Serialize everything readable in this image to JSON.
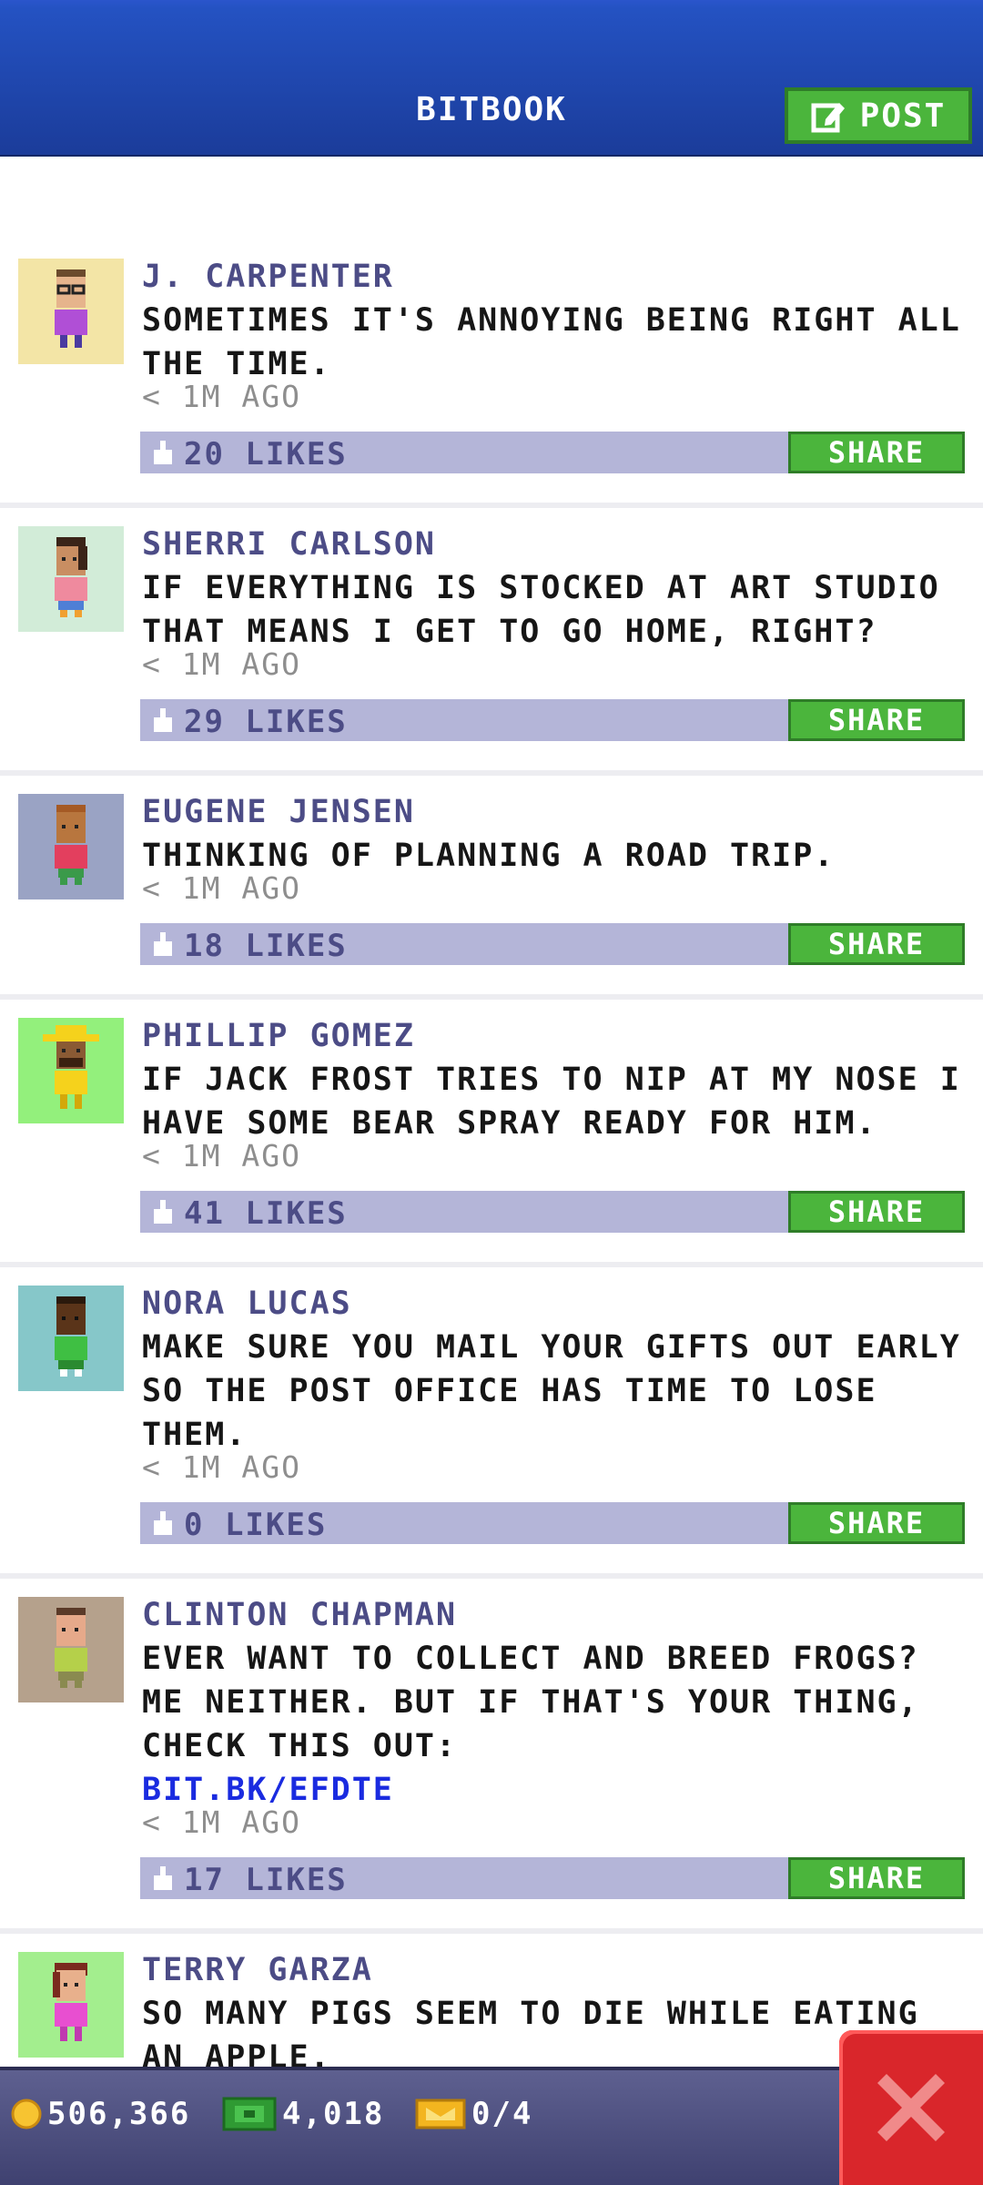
{
  "header": {
    "title": "BITBOOK",
    "post_label": "POST"
  },
  "posts": [
    {
      "name": "J. CARPENTER",
      "text": "SOMETIMES IT'S ANNOYING BEING RIGHT ALL THE TIME.",
      "time": "< 1M AGO",
      "likes": "20 LIKES",
      "share": "SHARE",
      "avatar_bg": "#f3e5a6",
      "skin": "#e6b48c",
      "shirt": "#b04fd6",
      "hair": "#6b4a2c"
    },
    {
      "name": "SHERRI CARLSON",
      "text": "IF EVERYTHING IS STOCKED AT ART STUDIO THAT MEANS I GET TO GO HOME, RIGHT?",
      "time": "< 1M AGO",
      "likes": "29 LIKES",
      "share": "SHARE",
      "avatar_bg": "#d2ecd8",
      "skin": "#c98e62",
      "shirt": "#ef8a9e",
      "hair": "#3a2418"
    },
    {
      "name": "EUGENE JENSEN",
      "text": "THINKING OF PLANNING A ROAD TRIP.",
      "time": "< 1M AGO",
      "likes": "18 LIKES",
      "share": "SHARE",
      "avatar_bg": "#9aa3c4",
      "skin": "#b8763e",
      "shirt": "#e33f5e",
      "hair": "#a55a25"
    },
    {
      "name": "PHILLIP GOMEZ",
      "text": "IF JACK FROST TRIES TO NIP AT MY NOSE I HAVE SOME BEAR SPRAY READY FOR HIM.",
      "time": "< 1M AGO",
      "likes": "41 LIKES",
      "share": "SHARE",
      "avatar_bg": "#93f07c",
      "skin": "#8a5a34",
      "shirt": "#f5d21c",
      "hair": "#f5d21c"
    },
    {
      "name": "NORA LUCAS",
      "text": "MAKE SURE YOU MAIL YOUR GIFTS OUT EARLY SO THE POST OFFICE HAS TIME TO LOSE THEM.",
      "time": "< 1M AGO",
      "likes": "0 LIKES",
      "share": "SHARE",
      "avatar_bg": "#86c7c9",
      "skin": "#5a3419",
      "shirt": "#3fbf43",
      "hair": "#2a190c"
    },
    {
      "name": "CLINTON CHAPMAN",
      "text": "EVER WANT TO COLLECT AND BREED FROGS? ME NEITHER. BUT IF THAT'S YOUR THING, CHECK THIS OUT:",
      "link": "BIT.BK/EFDTE",
      "time": "< 1M AGO",
      "likes": "17 LIKES",
      "share": "SHARE",
      "avatar_bg": "#b5a18c",
      "skin": "#e6a98a",
      "shirt": "#b5d04a",
      "hair": "#5a3a28"
    },
    {
      "name": "TERRY GARZA",
      "text": "SO MANY PIGS SEEM TO DIE WHILE EATING AN APPLE.",
      "time": "",
      "likes": "",
      "share": "",
      "avatar_bg": "#a3ee8e",
      "skin": "#e8b08c",
      "shirt": "#e84fd0",
      "hair": "#7a2a1e"
    }
  ],
  "footer": {
    "coins": "506,366",
    "bux": "4,018",
    "tickets": "0/4"
  },
  "colors": {
    "header_blue": "#1f46b0",
    "share_green": "#4bb53c",
    "likes_bar": "#b4b5d8",
    "name_color": "#4c4c86",
    "link_color": "#1a2be0",
    "close_red": "#d9262b"
  }
}
